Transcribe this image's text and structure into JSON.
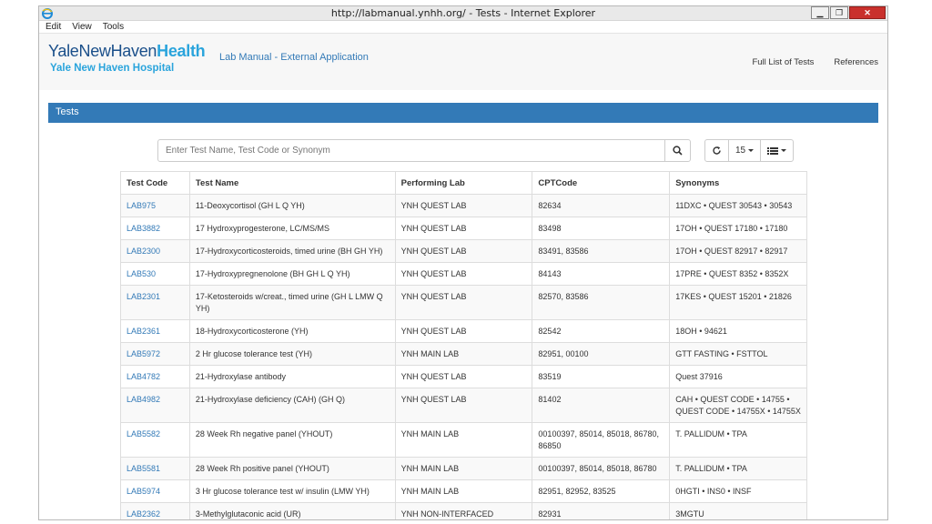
{
  "window": {
    "title": "http://labmanual.ynhh.org/ - Tests - Internet Explorer"
  },
  "menu": [
    "Edit",
    "View",
    "Tools"
  ],
  "header": {
    "logo_part1": "YaleNewHaven",
    "logo_part2": "Health",
    "logo_sub": "Yale New Haven Hospital",
    "app_title": "Lab Manual - External Application",
    "nav": [
      "Full List of Tests",
      "References"
    ]
  },
  "section_title": "Tests",
  "search": {
    "placeholder": "Enter Test Name, Test Code or Synonym"
  },
  "toolbar": {
    "page_size": "15"
  },
  "table": {
    "columns": [
      "Test Code",
      "Test Name",
      "Performing Lab",
      "CPTCode",
      "Synonyms"
    ],
    "rows": [
      [
        "LAB975",
        "11-Deoxycortisol (GH L Q YH)",
        "YNH QUEST LAB",
        "82634",
        "11DXC • QUEST 30543 • 30543"
      ],
      [
        "LAB3882",
        "17 Hydroxyprogesterone, LC/MS/MS",
        "YNH QUEST LAB",
        "83498",
        "17OH • QUEST 17180 • 17180"
      ],
      [
        "LAB2300",
        "17-Hydroxycorticosteroids, timed urine (BH GH YH)",
        "YNH QUEST LAB",
        "83491, 83586",
        "17OH • QUEST 82917 • 82917"
      ],
      [
        "LAB530",
        "17-Hydroxypregnenolone (BH GH L Q YH)",
        "YNH QUEST LAB",
        "84143",
        "17PRE • QUEST 8352 • 8352X"
      ],
      [
        "LAB2301",
        "17-Ketosteroids w/creat., timed urine (GH L LMW Q YH)",
        "YNH QUEST LAB",
        "82570, 83586",
        "17KES • QUEST 15201 • 21826"
      ],
      [
        "LAB2361",
        "18-Hydroxycorticosterone (YH)",
        "YNH QUEST LAB",
        "82542",
        "18OH • 94621"
      ],
      [
        "LAB5972",
        "2 Hr glucose tolerance test (YH)",
        "YNH MAIN LAB",
        "82951, 00100",
        "GTT FASTING • FSTTOL"
      ],
      [
        "LAB4782",
        "21-Hydroxylase antibody",
        "YNH QUEST LAB",
        "83519",
        "Quest 37916"
      ],
      [
        "LAB4982",
        "21-Hydroxylase deficiency (CAH) (GH Q)",
        "YNH QUEST LAB",
        "81402",
        "CAH • QUEST CODE • 14755 • QUEST CODE • 14755X • 14755X"
      ],
      [
        "LAB5582",
        "28 Week Rh negative panel (YHOUT)",
        "YNH MAIN LAB",
        "00100397, 85014, 85018, 86780, 86850",
        "T. PALLIDUM • TPA"
      ],
      [
        "LAB5581",
        "28 Week Rh positive panel (YHOUT)",
        "YNH MAIN LAB",
        "00100397, 85014, 85018, 86780",
        "T. PALLIDUM • TPA"
      ],
      [
        "LAB5974",
        "3 Hr glucose tolerance test w/ insulin (LMW YH)",
        "YNH MAIN LAB",
        "82951, 82952, 83525",
        "0HGTI • INS0 • INSF"
      ],
      [
        "LAB2362",
        "3-Methylglutaconic acid (UR)",
        "YNH NON-INTERFACED",
        "82931",
        "3MGTU"
      ]
    ]
  }
}
